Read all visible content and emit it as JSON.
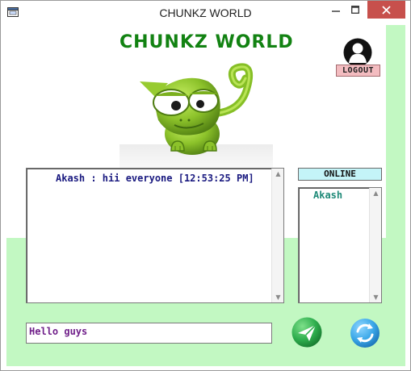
{
  "window": {
    "title": "CHUNKZ WORLD"
  },
  "titlebar_buttons": {
    "minimize_icon": "minimize-icon",
    "maximize_icon": "maximize-icon",
    "close_icon": "close-icon"
  },
  "header": {
    "app_name": "CHUNKZ WORLD",
    "logout_label": "LOGOUT"
  },
  "chat": {
    "messages": [
      {
        "text": "Akash : hii everyone [12:53:25 PM]"
      }
    ]
  },
  "online": {
    "label": "ONLINE",
    "users": [
      "Akash"
    ]
  },
  "composer": {
    "value": "Hello guys"
  },
  "colors": {
    "accent_green": "#128212",
    "panel_green": "#c2f8c2",
    "online_header_bg": "#c4f4f8",
    "logout_bg": "#f3bcc0",
    "chat_text": "#1a1a80",
    "online_user_text": "#1f8a78",
    "input_text": "#70208a",
    "close_button": "#c7504c",
    "send_button": "#2fae4e",
    "refresh_button": "#3aa7e8"
  },
  "icons": {
    "user": "user-icon",
    "send": "send-icon",
    "refresh": "refresh-icon",
    "mascot": "chameleon-mascot"
  }
}
